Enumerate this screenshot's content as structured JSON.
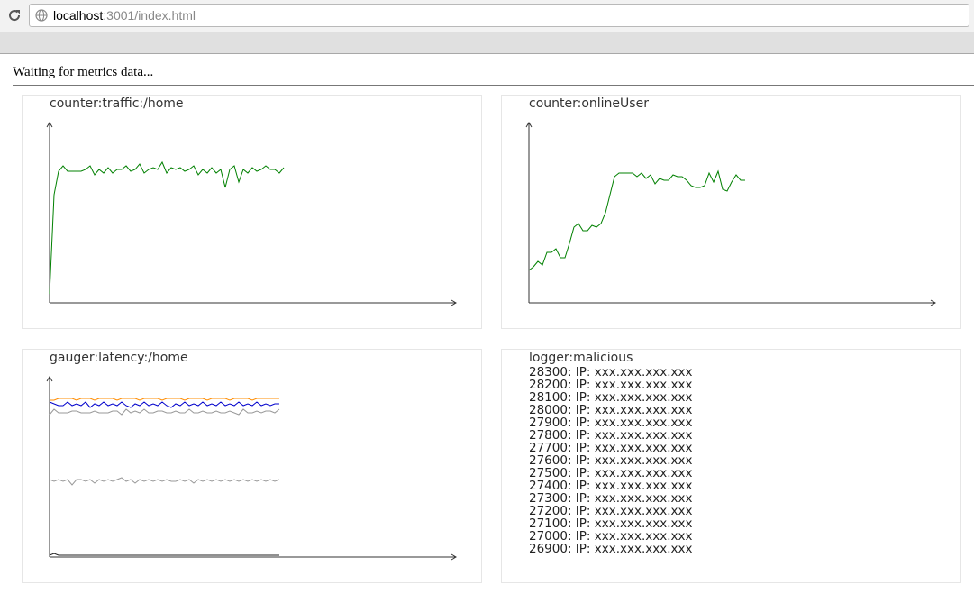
{
  "browser": {
    "url_host": "localhost",
    "url_rest": ":3001/index.html"
  },
  "page": {
    "status": "Waiting for metrics data..."
  },
  "colors": {
    "green": "#008000",
    "orange": "#ff8c00",
    "blue": "#0000cc",
    "gray": "#999999",
    "black": "#222222"
  },
  "panels": {
    "traffic": {
      "title": "counter:traffic:/home"
    },
    "online": {
      "title": "counter:onlineUser"
    },
    "latency": {
      "title": "gauger:latency:/home"
    },
    "logger": {
      "title": "logger:malicious",
      "entries": [
        "28300: IP: xxx.xxx.xxx.xxx",
        "28200: IP: xxx.xxx.xxx.xxx",
        "28100: IP: xxx.xxx.xxx.xxx",
        "28000: IP: xxx.xxx.xxx.xxx",
        "27900: IP: xxx.xxx.xxx.xxx",
        "27800: IP: xxx.xxx.xxx.xxx",
        "27700: IP: xxx.xxx.xxx.xxx",
        "27600: IP: xxx.xxx.xxx.xxx",
        "27500: IP: xxx.xxx.xxx.xxx",
        "27400: IP: xxx.xxx.xxx.xxx",
        "27300: IP: xxx.xxx.xxx.xxx",
        "27200: IP: xxx.xxx.xxx.xxx",
        "27100: IP: xxx.xxx.xxx.xxx",
        "27000: IP: xxx.xxx.xxx.xxx",
        "26900: IP: xxx.xxx.xxx.xxx"
      ]
    }
  },
  "chart_data": [
    {
      "type": "line",
      "title": "counter:traffic:/home",
      "ylim": [
        0,
        100
      ],
      "series": [
        {
          "color": "#008000",
          "values": [
            5,
            60,
            73,
            76,
            73,
            73,
            73,
            73,
            74,
            76,
            71,
            74,
            72,
            75,
            72,
            74,
            74,
            76,
            73,
            74,
            77,
            72,
            74,
            75,
            74,
            78,
            72,
            75,
            74,
            75,
            73,
            74,
            76,
            71,
            74,
            72,
            75,
            72,
            74,
            64,
            74,
            76,
            67,
            74,
            72,
            75,
            73,
            74,
            76,
            74,
            74,
            72,
            75
          ]
        }
      ]
    },
    {
      "type": "line",
      "title": "counter:onlineUser",
      "ylim": [
        0,
        100
      ],
      "series": [
        {
          "color": "#008000",
          "values": [
            18,
            20,
            23,
            21,
            28,
            28,
            30,
            25,
            25,
            33,
            42,
            44,
            40,
            40,
            43,
            42,
            44,
            50,
            60,
            70,
            72,
            72,
            72,
            72,
            70,
            72,
            69,
            71,
            66,
            69,
            68,
            68,
            71,
            70,
            70,
            68,
            65,
            64,
            64,
            65,
            72,
            67,
            73,
            63,
            62,
            67,
            71,
            68,
            68
          ]
        }
      ]
    },
    {
      "type": "line",
      "title": "gauger:latency:/home",
      "ylim": [
        0,
        100
      ],
      "series": [
        {
          "color": "#ff8c00",
          "values": [
            87,
            87,
            88,
            88,
            88,
            88,
            87,
            88,
            88,
            88,
            87,
            88,
            88,
            88,
            88,
            87,
            88,
            88,
            88,
            88,
            87,
            88,
            88,
            88,
            88,
            87,
            88,
            88,
            88,
            88,
            87,
            88,
            88,
            88,
            88,
            87,
            88,
            88,
            88,
            88,
            87,
            88,
            88,
            88,
            88,
            87,
            88,
            88,
            88,
            88,
            88,
            88
          ]
        },
        {
          "color": "#0000cc",
          "values": [
            86,
            85,
            84,
            84,
            86,
            84,
            85,
            84,
            86,
            83,
            85,
            84,
            86,
            84,
            85,
            84,
            86,
            84,
            83,
            85,
            84,
            86,
            84,
            85,
            84,
            86,
            84,
            83,
            85,
            84,
            86,
            84,
            85,
            84,
            86,
            84,
            85,
            84,
            86,
            84,
            85,
            84,
            86,
            84,
            85,
            84,
            86,
            84,
            85,
            84,
            85,
            85
          ]
        },
        {
          "color": "#999999",
          "values": [
            79,
            82,
            80,
            80,
            80,
            81,
            81,
            80,
            80,
            80,
            81,
            80,
            80,
            80,
            81,
            81,
            79,
            82,
            80,
            81,
            80,
            82,
            80,
            80,
            81,
            81,
            80,
            80,
            81,
            80,
            80,
            82,
            80,
            80,
            81,
            80,
            80,
            81,
            80,
            80,
            81,
            80,
            79,
            82,
            80,
            80,
            81,
            80,
            81,
            81,
            80,
            82
          ]
        },
        {
          "color": "#999999",
          "values": [
            43,
            42,
            43,
            42,
            43,
            40,
            43,
            43,
            42,
            43,
            41,
            43,
            42,
            43,
            42,
            43,
            44,
            42,
            43,
            41,
            43,
            42,
            43,
            42,
            43,
            42,
            43,
            42,
            42,
            43,
            42,
            43,
            41,
            43,
            42,
            43,
            42,
            43,
            42,
            43,
            42,
            43,
            42,
            43,
            42,
            43,
            42,
            43,
            42,
            43,
            42,
            43
          ]
        },
        {
          "color": "#222222",
          "values": [
            1,
            2,
            1,
            1,
            1,
            1,
            1,
            1,
            1,
            1,
            1,
            1,
            1,
            1,
            1,
            1,
            1,
            1,
            1,
            1,
            1,
            1,
            1,
            1,
            1,
            1,
            1,
            1,
            1,
            1,
            1,
            1,
            1,
            1,
            1,
            1,
            1,
            1,
            1,
            1,
            1,
            1,
            1,
            1,
            1,
            1,
            1,
            1,
            1,
            1,
            1,
            1
          ]
        }
      ]
    }
  ]
}
